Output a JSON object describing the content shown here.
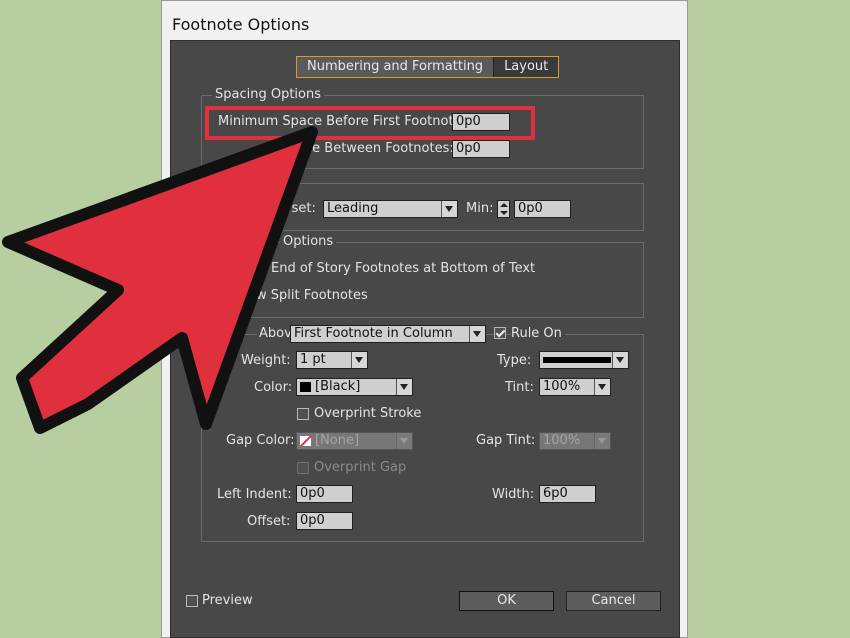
{
  "window": {
    "title": "Footnote Options"
  },
  "tabs": [
    {
      "label": "Numbering and Formatting"
    },
    {
      "label": "Layout"
    }
  ],
  "spacing": {
    "legend": "Spacing Options",
    "min_space_label": "Minimum Space Before First Footnote:",
    "min_space_value": "0p0",
    "between_label": "ce Between Footnotes:",
    "between_value": "0p0"
  },
  "first_baseline": {
    "offset_label": "fset:",
    "offset_value": "Leading",
    "min_label": "Min:",
    "min_value": "0p0"
  },
  "placement": {
    "legend": "Options",
    "end_of_story": "End of Story Footnotes at Bottom of Text",
    "allow_split": "w Split Footnotes"
  },
  "rule": {
    "above_label": "Above:",
    "above_value": "First Footnote in Column",
    "rule_on_label": "Rule On",
    "weight_label": "Weight:",
    "weight_value": "1 pt",
    "type_label": "Type:",
    "color_label": "Color:",
    "color_value": "[Black]",
    "tint_label": "Tint:",
    "tint_value": "100%",
    "overprint_stroke": "Overprint Stroke",
    "gap_color_label": "Gap Color:",
    "gap_color_value": "[None]",
    "gap_tint_label": "Gap Tint:",
    "gap_tint_value": "100%",
    "overprint_gap": "Overprint Gap",
    "left_indent_label": "Left Indent:",
    "left_indent_value": "0p0",
    "width_label": "Width:",
    "width_value": "6p0",
    "offset_label": "Offset:",
    "offset_value": "0p0"
  },
  "footer": {
    "preview_label": "Preview",
    "ok_label": "OK",
    "cancel_label": "Cancel"
  },
  "colors": {
    "highlight": "#e0303d",
    "arrow_fill": "#e0303d",
    "tab_border": "#e0962b",
    "panel": "#484848",
    "background": "#b6cea0"
  }
}
